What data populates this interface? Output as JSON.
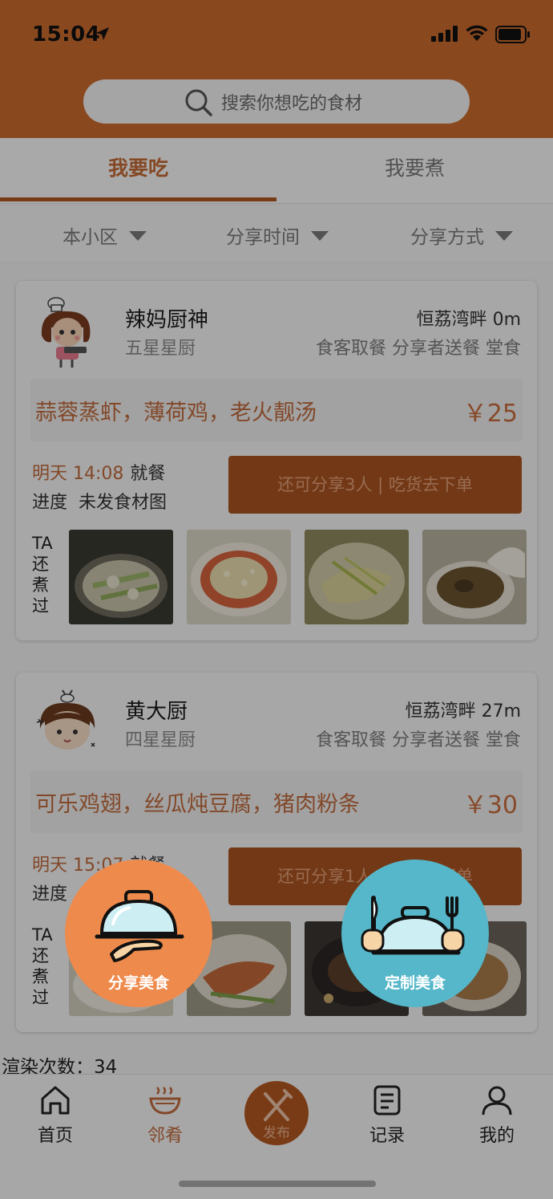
{
  "status": {
    "time": "15:04"
  },
  "search": {
    "placeholder": "搜索你想吃的食材"
  },
  "tabs": [
    {
      "label": "我要吃"
    },
    {
      "label": "我要煮"
    }
  ],
  "filters": [
    {
      "label": "本小区"
    },
    {
      "label": "分享时间"
    },
    {
      "label": "分享方式"
    }
  ],
  "cards": [
    {
      "chef_name": "辣妈厨神",
      "rank": "五星星厨",
      "location": "恒荔湾畔 0m",
      "modes": "食客取餐 分享者送餐 堂食",
      "menu": "蒜蓉蒸虾，薄荷鸡，老火靓汤",
      "price": "￥25",
      "time": "明天 14:08",
      "meal": "就餐",
      "progress_label": "进度",
      "progress_value": "未发食材图",
      "button": "还可分享3人 | 吃货去下单",
      "history_label": "TA 还 煮 过"
    },
    {
      "chef_name": "黄大厨",
      "rank": "四星星厨",
      "location": "恒荔湾畔 27m",
      "modes": "食客取餐 分享者送餐 堂食",
      "menu": "可乐鸡翅，丝瓜炖豆腐，猪肉粉条",
      "price": "￥30",
      "time": "明天 15:07",
      "meal": "就餐",
      "progress_label": "进度",
      "progress_value": "",
      "button": "还可分享1人 | 吃货去下单",
      "history_label": "TA 还 煮 过"
    }
  ],
  "render_count": "渲染次数：34",
  "nav": [
    {
      "label": "首页",
      "icon": "home-icon"
    },
    {
      "label": "邻肴",
      "icon": "bowl-icon"
    },
    {
      "label": "发布",
      "icon": "fork-knife-icon"
    },
    {
      "label": "记录",
      "icon": "notes-icon"
    },
    {
      "label": "我的",
      "icon": "user-icon"
    }
  ],
  "overlay": {
    "share_label": "分享美食",
    "custom_label": "定制美食"
  },
  "colors": {
    "brand": "#cc6b2f",
    "share_fab": "#ee8a4c",
    "custom_fab": "#55b7c9"
  }
}
